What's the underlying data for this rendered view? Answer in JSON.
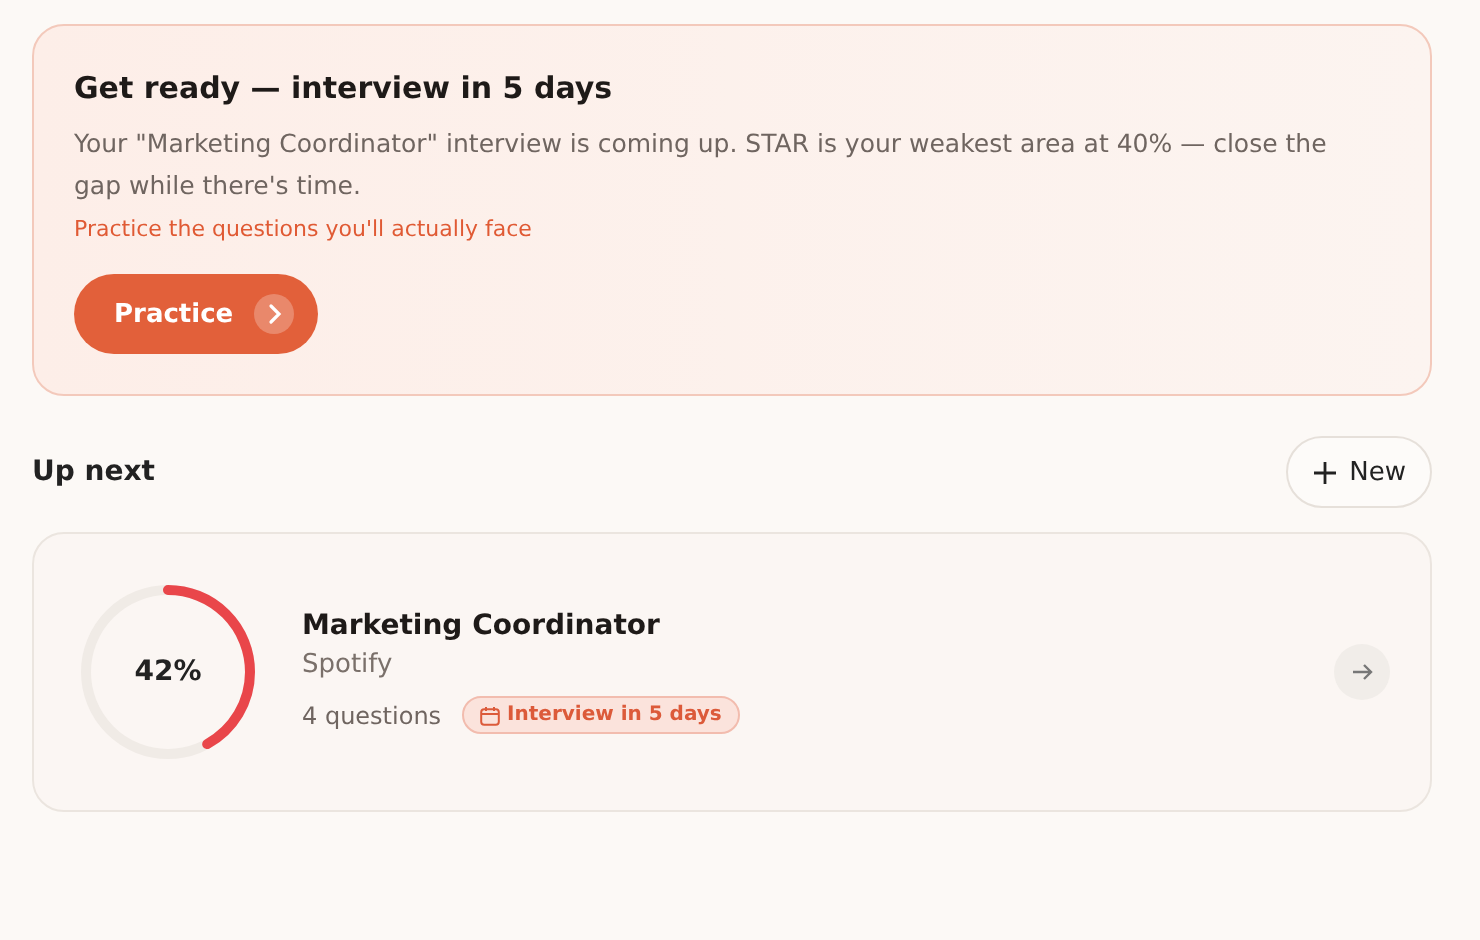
{
  "banner": {
    "title": "Get ready — interview in 5 days",
    "message": "Your \"Marketing Coordinator\" interview is coming up. STAR is your weakest area at 40% — close the gap while there's time.",
    "hint": "Practice the questions you'll actually face",
    "button": "Practice"
  },
  "section": {
    "title": "Up next",
    "new_button": "New"
  },
  "items": [
    {
      "percent": "42%",
      "level": 0.42,
      "title": "Marketing Coordinator",
      "company": "Spotify",
      "questions": "4 questions",
      "badge": "Interview in 5 days"
    }
  ]
}
